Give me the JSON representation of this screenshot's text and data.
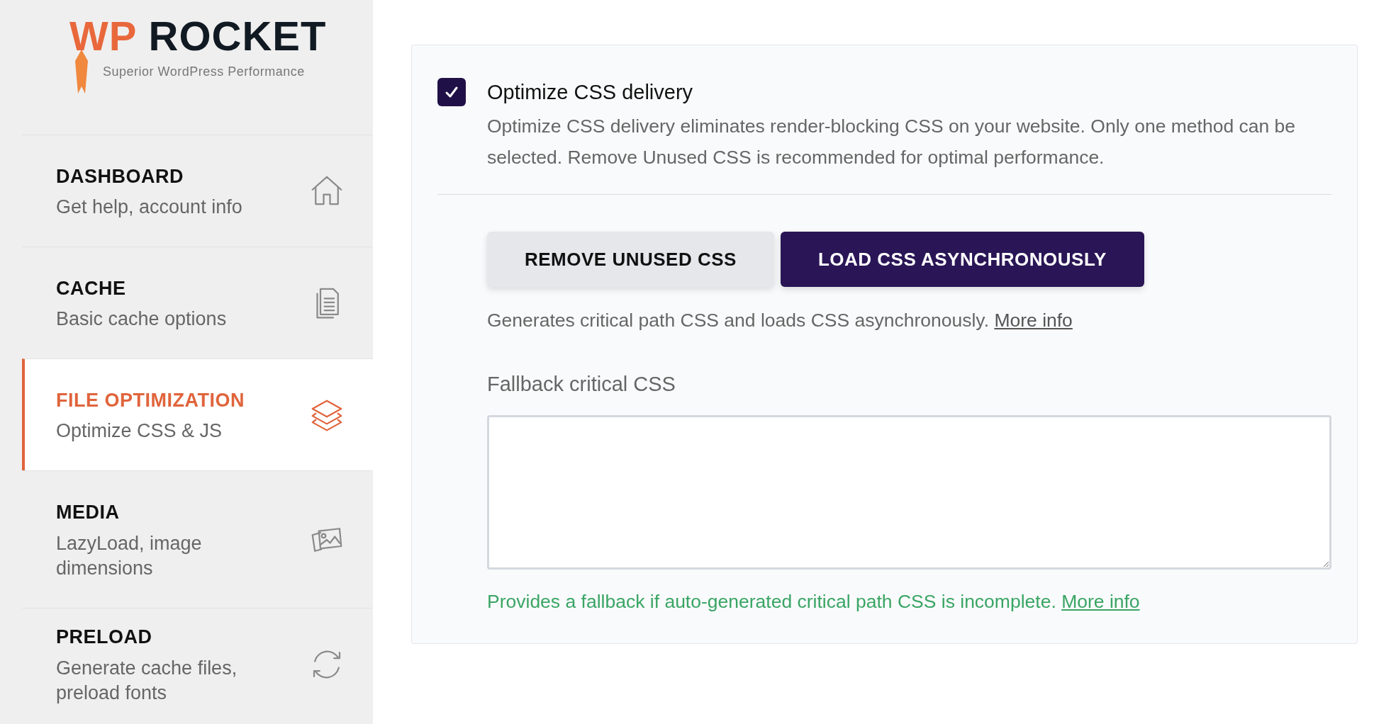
{
  "logo": {
    "accent": "WP",
    "name": "ROCKET",
    "tagline": "Superior WordPress Performance"
  },
  "sidebar": {
    "items": [
      {
        "title": "DASHBOARD",
        "subtitle": "Get help, account info",
        "kind": "home",
        "selected": false
      },
      {
        "title": "CACHE",
        "subtitle": "Basic cache options",
        "kind": "document",
        "selected": false
      },
      {
        "title": "FILE OPTIMIZATION",
        "subtitle": "Optimize CSS & JS",
        "kind": "layers",
        "selected": true
      },
      {
        "title": "MEDIA",
        "subtitle": "LazyLoad, image dimensions",
        "kind": "images",
        "selected": false
      },
      {
        "title": "PRELOAD",
        "subtitle": "Generate cache files, preload fonts",
        "kind": "refresh",
        "selected": false
      }
    ]
  },
  "option": {
    "title": "Optimize CSS delivery",
    "checked": true,
    "description": "Optimize CSS delivery eliminates render-blocking CSS on your website. Only one method can be selected. Remove Unused CSS is recommended for optimal performance."
  },
  "methods": [
    {
      "label": "REMOVE UNUSED CSS",
      "selected": false
    },
    {
      "label": "LOAD CSS ASYNCHRONOUSLY",
      "selected": true
    }
  ],
  "method_help": {
    "text": "Generates critical path CSS and loads CSS asynchronously.",
    "link": "More info"
  },
  "fallback": {
    "label": "Fallback critical CSS",
    "hint": "Provides a fallback if auto-generated critical path CSS is incomplete.",
    "link": "More info"
  }
}
